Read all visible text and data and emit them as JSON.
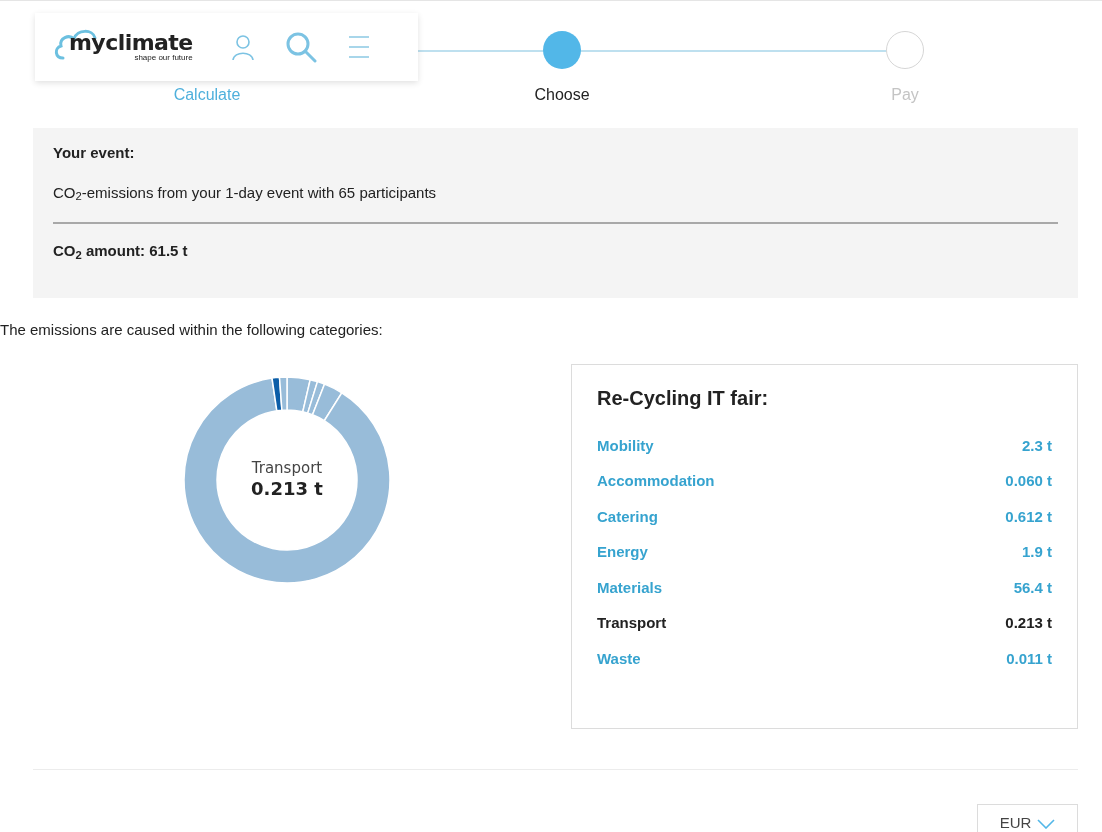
{
  "header": {
    "logo": {
      "wordmark": "myclimate",
      "tagline": "shape our future"
    }
  },
  "steps": [
    {
      "label": "Calculate",
      "selected": false,
      "completed": true
    },
    {
      "label": "Choose",
      "selected": true,
      "completed": false
    },
    {
      "label": "Pay",
      "selected": false,
      "completed": false
    }
  ],
  "event_box": {
    "title": "Your event:",
    "description": "CO$_{2}$-emissions from your 1-day event with 65 participants",
    "amount": "CO$_{2}$ amount: 61.5 t"
  },
  "intro": "The emissions are caused within the following categories:",
  "chart": {
    "center_label": "Transport",
    "center_value": "0.213 t"
  },
  "breakdown": {
    "title": "Re-Cycling IT fair:",
    "items": [
      {
        "label": "Mobility",
        "value": "2.3 t",
        "selected": false
      },
      {
        "label": "Accommodation",
        "value": "0.060 t",
        "selected": false
      },
      {
        "label": "Catering",
        "value": "0.612 t",
        "selected": false
      },
      {
        "label": "Energy",
        "value": "1.9 t",
        "selected": false
      },
      {
        "label": "Materials",
        "value": "56.4 t",
        "selected": false
      },
      {
        "label": "Transport",
        "value": "0.213 t",
        "selected": true
      },
      {
        "label": "Waste",
        "value": "0.011 t",
        "selected": false
      }
    ]
  },
  "currency": {
    "value": "EUR"
  }
}
